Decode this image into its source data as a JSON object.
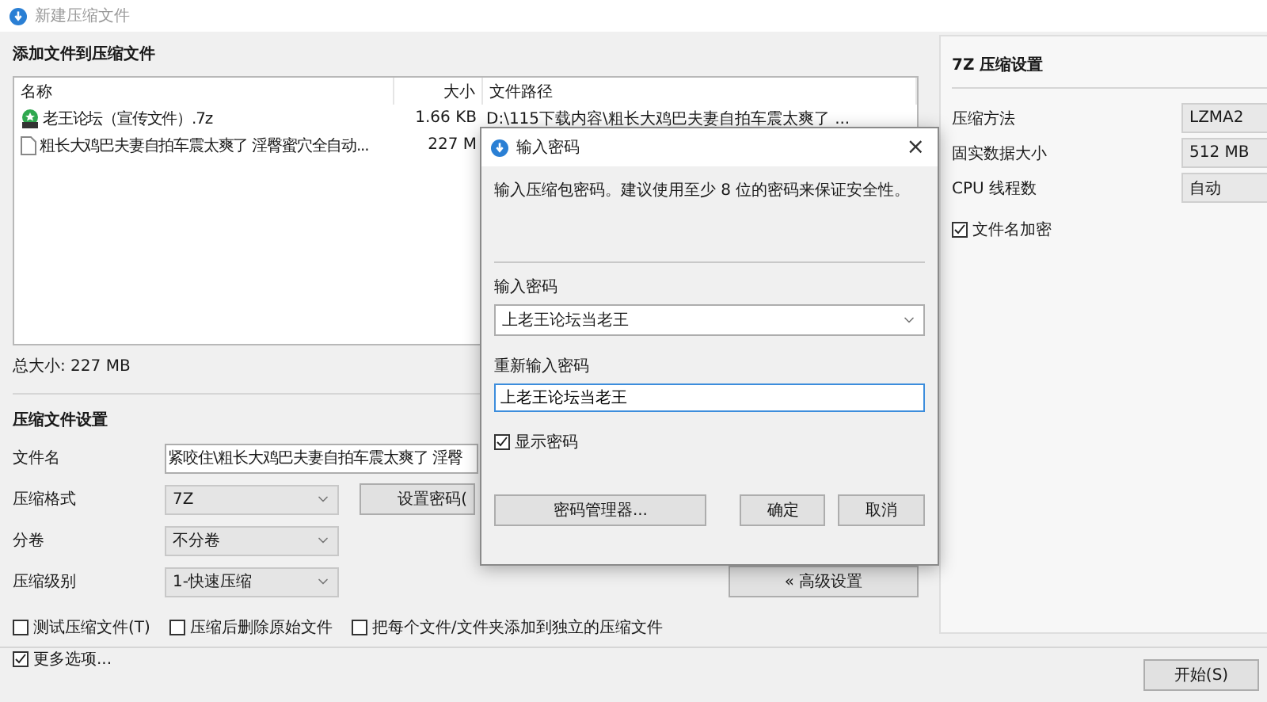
{
  "window": {
    "title": "新建压缩文件"
  },
  "files": {
    "heading": "添加文件到压缩文件",
    "columns": [
      "名称",
      "大小",
      "文件路径"
    ],
    "rows": [
      {
        "kind": "archive",
        "name": "老王论坛（宣传文件）.7z",
        "size": "1.66 KB",
        "path": "D:\\115下载内容\\粗长大鸡巴夫妻自拍车震太爽了 ..."
      },
      {
        "kind": "file",
        "name": "粗长大鸡巴夫妻自拍车震太爽了 淫臀蜜穴全自动...",
        "size": "227 M"
      }
    ],
    "total": "总大小: 227 MB"
  },
  "settings": {
    "heading": "压缩文件设置",
    "fields": [
      {
        "kind": "text",
        "label": "文件名",
        "value": "紧咬住\\粗长大鸡巴夫妻自拍车震太爽了 淫臀"
      },
      {
        "kind": "select",
        "label": "压缩格式",
        "value": "7Z",
        "button": "设置密码("
      },
      {
        "kind": "select",
        "label": "分卷",
        "value": "不分卷"
      },
      {
        "kind": "select",
        "label": "压缩级别",
        "value": "1-快速压缩",
        "button": "« 高级设置"
      }
    ],
    "options": [
      {
        "label": "测试压缩文件(T)",
        "checked": false
      },
      {
        "label": "压缩后删除原始文件",
        "checked": false
      },
      {
        "label": "把每个文件/文件夹添加到独立的压缩文件",
        "checked": false
      }
    ]
  },
  "compression_panel": {
    "title": "7Z 压缩设置",
    "fields": [
      {
        "label": "压缩方法",
        "value": "LZMA2"
      },
      {
        "label": "固实数据大小",
        "value": "512 MB"
      },
      {
        "label": "CPU 线程数",
        "value": "自动"
      }
    ],
    "encrypt_names": {
      "label": "文件名加密",
      "checked": true
    }
  },
  "more_options": {
    "label": "更多选项...",
    "checked": true
  },
  "start_button": "开始(S)",
  "password_dialog": {
    "title": "输入密码",
    "close": "×",
    "description": "输入压缩包密码。建议使用至少 8 位的密码来保证安全性。",
    "password_label": "输入密码",
    "password_value": "上老王论坛当老王",
    "confirm_label": "重新输入密码",
    "confirm_value": "上老王论坛当老王",
    "show_password": {
      "label": "显示密码",
      "checked": true
    },
    "buttons": {
      "manager": "密码管理器...",
      "ok": "确定",
      "cancel": "取消"
    }
  }
}
